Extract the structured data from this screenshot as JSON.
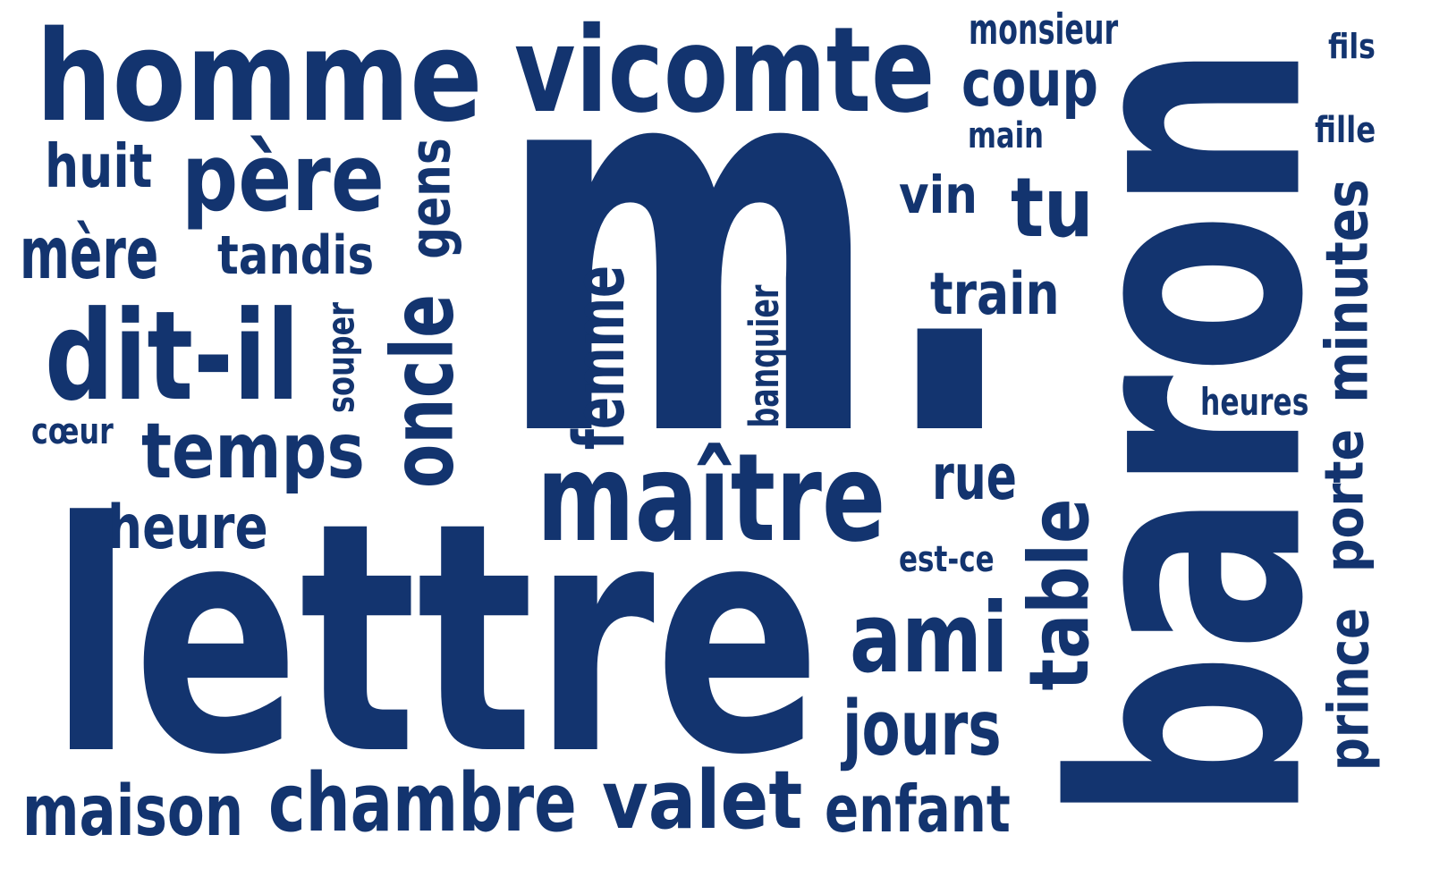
{
  "color": "#13346f",
  "words": {
    "homme": "homme",
    "vicomte": "vicomte",
    "monsieur": "monsieur",
    "coup": "coup",
    "main": "main",
    "fils": "fils",
    "fille": "fille",
    "huit": "huit",
    "pere": "père",
    "gens": "gens",
    "mere": "mère",
    "tandis": "tandis",
    "m": "m.",
    "vin": "vin",
    "tu": "tu",
    "train": "train",
    "baron": "baron",
    "minutes": "minutes",
    "heures": "heures",
    "porte": "porte",
    "prince": "prince",
    "ditil": "dit-il",
    "souper": "souper",
    "oncle": "oncle",
    "femme": "femme",
    "banquier": "banquier",
    "coeur": "cœur",
    "temps": "temps",
    "maitre": "maître",
    "rue": "rue",
    "table": "table",
    "heure": "heure",
    "estce": "est-ce",
    "lettre": "lettre",
    "ami": "ami",
    "jours": "jours",
    "maison": "maison",
    "chambre": "chambre",
    "valet": "valet",
    "enfant": "enfant"
  }
}
